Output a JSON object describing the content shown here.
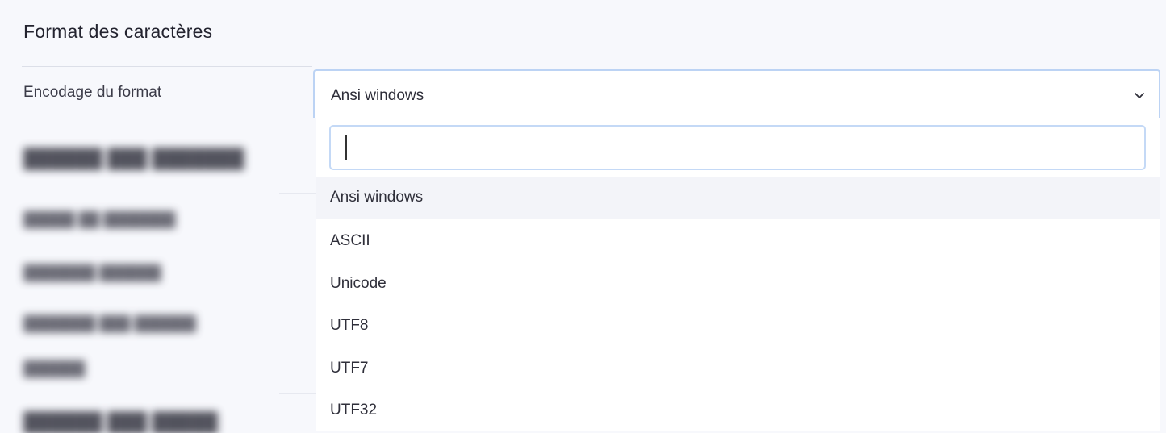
{
  "section": {
    "title": "Format des caractères"
  },
  "encoding_field": {
    "label": "Encodage du format",
    "selected_value": "Ansi windows"
  },
  "dropdown": {
    "search_value": "",
    "options": [
      {
        "label": "Ansi windows",
        "highlighted": true
      },
      {
        "label": "ASCII"
      },
      {
        "label": "Unicode"
      },
      {
        "label": "UTF8"
      },
      {
        "label": "UTF7"
      },
      {
        "label": "UTF32"
      }
    ]
  },
  "icons": {
    "select_chevron": "chevron-down-icon"
  },
  "colors": {
    "background": "#f7f8fc",
    "select_border": "#bcd3f4",
    "option_highlight": "#f3f4f9"
  }
}
